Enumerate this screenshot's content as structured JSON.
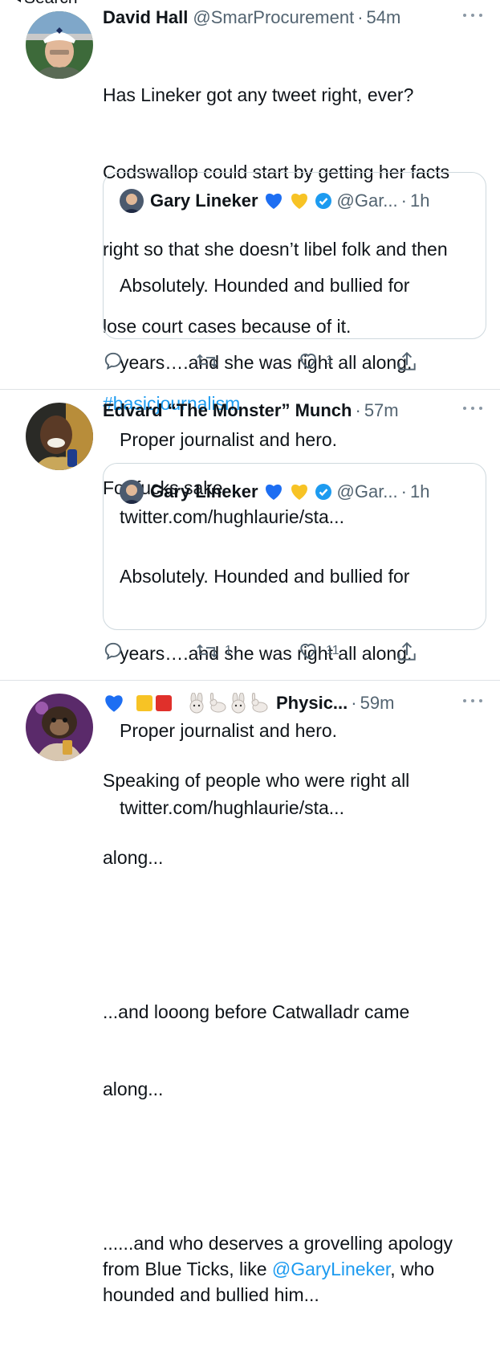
{
  "nav": {
    "back_label": "Search"
  },
  "tweets": [
    {
      "name": "David Hall",
      "handle": "@SmarProcurement",
      "sep": "·",
      "time": "54m",
      "text_lines": [
        "Has Lineker got any tweet right, ever?",
        "Codswallop could start by getting her facts",
        "right so that she doesn’t libel folk and then",
        "lose court cases because of it."
      ],
      "hashtag": "#basicjournalism",
      "quote": {
        "name": "Gary Lineker",
        "handle": "@Gar...",
        "sep": "·",
        "time": "1h",
        "text_lines": [
          "Absolutely. Hounded and bullied for",
          "years….and she was right all along.",
          "Proper journalist and hero.",
          "twitter.com/hughlaurie/sta..."
        ]
      },
      "actions": {
        "replies": "",
        "retweets": "",
        "likes": "1"
      }
    },
    {
      "name": "Edvard “The Monster” Munch",
      "handle": "",
      "sep": "·",
      "time": "57m",
      "text_lines": [
        "For fucks sake"
      ],
      "quote": {
        "name": "Gary Lineker",
        "handle": "@Gar...",
        "sep": "·",
        "time": "1h",
        "text_lines": [
          "Absolutely. Hounded and bullied for",
          "years….and she was right all along.",
          "Proper journalist and hero.",
          "twitter.com/hughlaurie/sta..."
        ]
      },
      "actions": {
        "replies": "",
        "retweets": "1",
        "likes": "11"
      }
    },
    {
      "name": "Physic...",
      "handle": "",
      "sep": "·",
      "time": "59m",
      "text_lines": [
        "Speaking of people who were right all",
        "along...",
        "",
        "...and looong before Catwalladr came",
        "along..."
      ],
      "text_tail_pre": "......and who deserves a grovelling apology\nfrom Blue Ticks, like ",
      "mention": "@GaryLineker",
      "text_tail_post": ", who\nhounded and bullied him..."
    }
  ],
  "colors": {
    "link": "#1d9bf0",
    "secondary": "#536471",
    "heart_blue": "#1d6ef2",
    "heart_yellow": "#f7c325",
    "verified": "#1d9bf0"
  },
  "icons": [
    "reply-icon",
    "retweet-icon",
    "like-icon",
    "share-icon",
    "verified-icon",
    "blue-heart-emoji",
    "yellow-heart-emoji",
    "rabbit-emoji"
  ]
}
